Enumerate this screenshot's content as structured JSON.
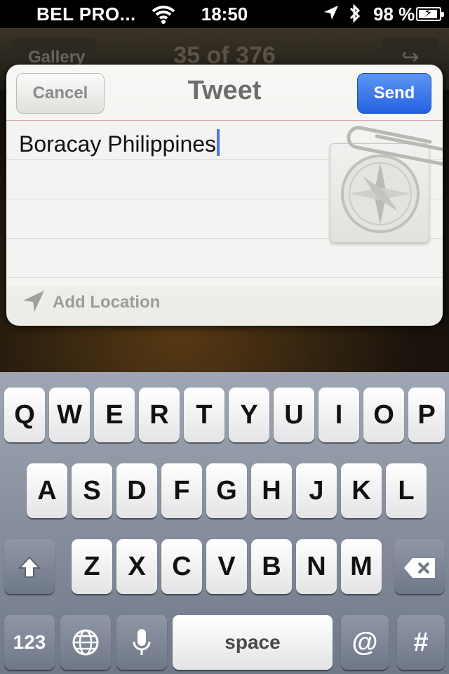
{
  "status_bar": {
    "carrier": "BEL PRO...",
    "time": "18:50",
    "battery": "98 %"
  },
  "background_app": {
    "back_label": "Gallery",
    "counter": "35 of 376"
  },
  "tweet_sheet": {
    "title": "Tweet",
    "cancel_label": "Cancel",
    "send_label": "Send",
    "text": "Boracay Philippines",
    "attachment_icon": "safari-compass-icon",
    "add_location_label": "Add Location"
  },
  "keyboard": {
    "row1": [
      "Q",
      "W",
      "E",
      "R",
      "T",
      "Y",
      "U",
      "I",
      "O",
      "P"
    ],
    "row2": [
      "A",
      "S",
      "D",
      "F",
      "G",
      "H",
      "J",
      "K",
      "L"
    ],
    "row3": [
      "Z",
      "X",
      "C",
      "V",
      "B",
      "N",
      "M"
    ],
    "numbers_label": "123",
    "space_label": "space",
    "at_label": "@",
    "hash_label": "#"
  },
  "colors": {
    "send_blue": "#2461e0",
    "keyboard_bg": "#7f8796",
    "caret": "#4a78e8"
  }
}
